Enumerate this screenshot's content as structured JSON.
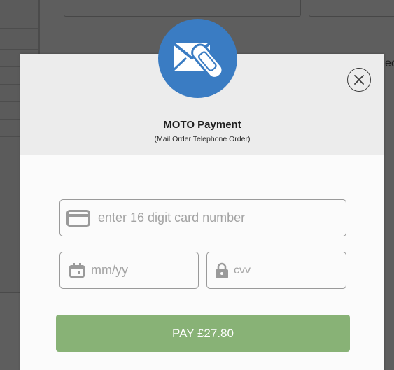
{
  "background": {
    "partial_text": "ec"
  },
  "modal": {
    "title": "MOTO Payment",
    "subtitle": "(Mail Order Telephone Order)",
    "logo_icon": "mail-phone-icon",
    "close_icon": "close-icon"
  },
  "form": {
    "card_number": {
      "placeholder": "enter 16 digit card number",
      "value": "",
      "icon": "credit-card-icon"
    },
    "expiry": {
      "placeholder": "mm/yy",
      "value": "",
      "icon": "calendar-icon"
    },
    "cvv": {
      "placeholder": "cvv",
      "value": "",
      "icon": "lock-icon"
    }
  },
  "pay_button": {
    "label": "PAY £27.80"
  },
  "colors": {
    "accent_blue": "#3a7cc3",
    "pay_green": "#88b276",
    "header_gray": "#ececec",
    "overlay": "#5e5e5e"
  }
}
